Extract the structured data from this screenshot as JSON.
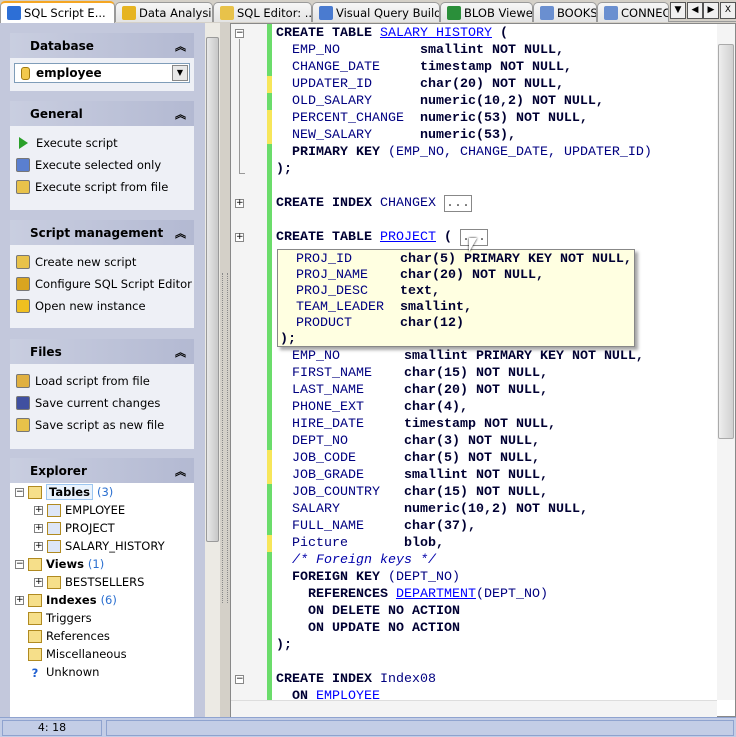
{
  "tabs": [
    {
      "label": "SQL Script E...",
      "icon": "lightning-script-icon",
      "active": true
    },
    {
      "label": "Data Analysis",
      "icon": "cube-icon"
    },
    {
      "label": "SQL Editor: ...",
      "icon": "database-doc-icon"
    },
    {
      "label": "Visual Query Builder",
      "icon": "builder-icon"
    },
    {
      "label": "BLOB Viewer",
      "icon": "image-icon"
    },
    {
      "label": "BOOKS",
      "icon": "table-icon"
    },
    {
      "label": "CONNEC",
      "icon": "table-icon"
    }
  ],
  "tab_controls": {
    "list": "▼",
    "prev": "◀",
    "next": "▶",
    "close": "X"
  },
  "panels": {
    "database": {
      "title": "Database",
      "selected": "employee"
    },
    "general": {
      "title": "General",
      "items": [
        {
          "label": "Execute script",
          "icon": "play-icon"
        },
        {
          "label": "Execute selected only",
          "icon": "execute-selected-icon"
        },
        {
          "label": "Execute script from file",
          "icon": "execute-file-icon"
        }
      ]
    },
    "script": {
      "title": "Script management",
      "items": [
        {
          "label": "Create new script",
          "icon": "new-script-icon"
        },
        {
          "label": "Configure SQL Script Editor",
          "icon": "configure-icon"
        },
        {
          "label": "Open new instance",
          "icon": "new-instance-icon"
        }
      ]
    },
    "files": {
      "title": "Files",
      "items": [
        {
          "label": "Load script from file",
          "icon": "load-icon"
        },
        {
          "label": "Save current changes",
          "icon": "save-icon"
        },
        {
          "label": "Save script as new file",
          "icon": "save-as-icon"
        }
      ]
    },
    "explorer": {
      "title": "Explorer",
      "tree": [
        {
          "label": "Tables",
          "count": "(3)",
          "bold": true,
          "level": 0,
          "exp": "−",
          "icon": "tables-folder-icon"
        },
        {
          "label": "EMPLOYEE",
          "level": 1,
          "exp": "+",
          "icon": "table-icon"
        },
        {
          "label": "PROJECT",
          "level": 1,
          "exp": "+",
          "icon": "table-icon"
        },
        {
          "label": "SALARY_HISTORY",
          "level": 1,
          "exp": "+",
          "icon": "table-icon"
        },
        {
          "label": "Views",
          "count": "(1)",
          "bold": true,
          "level": 0,
          "exp": "−",
          "icon": "views-folder-icon"
        },
        {
          "label": "BESTSELLERS",
          "level": 1,
          "exp": "+",
          "icon": "view-icon"
        },
        {
          "label": "Indexes",
          "count": "(6)",
          "bold": true,
          "level": 0,
          "exp": "+",
          "icon": "indexes-folder-icon"
        },
        {
          "label": "Triggers",
          "level": 0,
          "icon": "triggers-folder-icon"
        },
        {
          "label": "References",
          "level": 0,
          "icon": "references-folder-icon"
        },
        {
          "label": "Miscellaneous",
          "level": 0,
          "icon": "misc-icon"
        },
        {
          "label": "Unknown",
          "level": 0,
          "icon": "question-icon"
        }
      ]
    }
  },
  "editor": {
    "lines": [
      {
        "m": "g",
        "f": "−",
        "t": [
          [
            "kw",
            "CREATE TABLE "
          ],
          [
            "link",
            "SALARY_HISTORY"
          ],
          [
            "kw",
            " ("
          ]
        ]
      },
      {
        "m": "g",
        "t": [
          [
            "id",
            "  EMP_NO          "
          ],
          [
            "kw",
            "smallint NOT NULL,"
          ]
        ]
      },
      {
        "m": "g",
        "t": [
          [
            "id",
            "  CHANGE_DATE     "
          ],
          [
            "kw",
            "timestamp NOT NULL,"
          ]
        ]
      },
      {
        "m": "y",
        "t": [
          [
            "id",
            "  UPDATER_ID      "
          ],
          [
            "kw",
            "char(20) NOT NULL,"
          ]
        ]
      },
      {
        "m": "g",
        "t": [
          [
            "id",
            "  OLD_SALARY      "
          ],
          [
            "kw",
            "numeric(10,2) NOT NULL,"
          ]
        ]
      },
      {
        "m": "y",
        "t": [
          [
            "id",
            "  PERCENT_CHANGE  "
          ],
          [
            "kw",
            "numeric(53) NOT NULL,"
          ]
        ]
      },
      {
        "m": "y",
        "t": [
          [
            "id",
            "  NEW_SALARY      "
          ],
          [
            "kw",
            "numeric(53),"
          ]
        ]
      },
      {
        "m": "g",
        "t": [
          [
            "kw",
            "  PRIMARY KEY "
          ],
          [
            "id",
            "(EMP_NO, CHANGE_DATE, UPDATER_ID)"
          ]
        ]
      },
      {
        "m": "g",
        "t": [
          [
            "kw",
            ");"
          ]
        ]
      },
      {
        "m": "g",
        "t": []
      },
      {
        "m": "g",
        "f": "+",
        "t": [
          [
            "kw",
            "CREATE INDEX "
          ],
          [
            "id",
            "CHANGEX "
          ],
          [
            "bx",
            "..."
          ]
        ]
      },
      {
        "m": "g",
        "t": []
      },
      {
        "m": "g",
        "f": "+",
        "t": [
          [
            "kw",
            "CREATE TABLE "
          ],
          [
            "link",
            "PROJECT"
          ],
          [
            "kw",
            " ( "
          ],
          [
            "bx",
            "..."
          ]
        ]
      },
      {
        "m": "g",
        "t": []
      },
      {
        "m": "g",
        "t": []
      },
      {
        "m": "g",
        "t": []
      },
      {
        "m": "g",
        "t": []
      },
      {
        "m": "g",
        "t": []
      },
      {
        "m": "g",
        "t": []
      },
      {
        "m": "g",
        "t": [
          [
            "id",
            "  EMP_NO        "
          ],
          [
            "kw",
            "smallint PRIMARY KEY NOT NULL,"
          ]
        ]
      },
      {
        "m": "g",
        "t": [
          [
            "id",
            "  FIRST_NAME    "
          ],
          [
            "kw",
            "char(15) NOT NULL,"
          ]
        ]
      },
      {
        "m": "g",
        "t": [
          [
            "id",
            "  LAST_NAME     "
          ],
          [
            "kw",
            "char(20) NOT NULL,"
          ]
        ]
      },
      {
        "m": "g",
        "t": [
          [
            "id",
            "  PHONE_EXT     "
          ],
          [
            "kw",
            "char(4),"
          ]
        ]
      },
      {
        "m": "g",
        "t": [
          [
            "id",
            "  HIRE_DATE     "
          ],
          [
            "kw",
            "timestamp NOT NULL,"
          ]
        ]
      },
      {
        "m": "g",
        "t": [
          [
            "id",
            "  DEPT_NO       "
          ],
          [
            "kw",
            "char(3) NOT NULL,"
          ]
        ]
      },
      {
        "m": "y",
        "t": [
          [
            "id",
            "  JOB_CODE      "
          ],
          [
            "kw",
            "char(5) NOT NULL,"
          ]
        ]
      },
      {
        "m": "y",
        "t": [
          [
            "id",
            "  JOB_GRADE     "
          ],
          [
            "kw",
            "smallint NOT NULL,"
          ]
        ]
      },
      {
        "m": "g",
        "t": [
          [
            "id",
            "  JOB_COUNTRY   "
          ],
          [
            "kw",
            "char(15) NOT NULL,"
          ]
        ]
      },
      {
        "m": "g",
        "t": [
          [
            "id",
            "  SALARY        "
          ],
          [
            "kw",
            "numeric(10,2) NOT NULL,"
          ]
        ]
      },
      {
        "m": "g",
        "t": [
          [
            "id",
            "  FULL_NAME     "
          ],
          [
            "kw",
            "char(37),"
          ]
        ]
      },
      {
        "m": "y",
        "t": [
          [
            "id",
            "  Picture       "
          ],
          [
            "kw",
            "blob,"
          ]
        ]
      },
      {
        "m": "g",
        "t": [
          [
            "cm",
            "  /* Foreign keys */"
          ]
        ]
      },
      {
        "m": "g",
        "t": [
          [
            "kw",
            "  FOREIGN KEY "
          ],
          [
            "id",
            "(DEPT_NO)"
          ]
        ]
      },
      {
        "m": "g",
        "t": [
          [
            "kw",
            "    REFERENCES "
          ],
          [
            "link",
            "DEPARTMENT"
          ],
          [
            "id",
            "(DEPT_NO)"
          ]
        ]
      },
      {
        "m": "g",
        "t": [
          [
            "kw",
            "    ON DELETE NO ACTION"
          ]
        ]
      },
      {
        "m": "g",
        "t": [
          [
            "kw",
            "    ON UPDATE NO ACTION"
          ]
        ]
      },
      {
        "m": "g",
        "t": [
          [
            "kw",
            ");"
          ]
        ]
      },
      {
        "m": "g",
        "t": []
      },
      {
        "m": "g",
        "f": "−",
        "t": [
          [
            "kw",
            "CREATE INDEX "
          ],
          [
            "id",
            "Index08"
          ]
        ]
      },
      {
        "m": "g",
        "t": [
          [
            "kw",
            "  ON "
          ],
          [
            "link",
            "EMPLOYEE"
          ]
        ]
      }
    ],
    "tooltip": [
      [
        [
          "id",
          "  PROJ_ID      "
        ],
        [
          "kw",
          "char(5) PRIMARY KEY NOT NULL,"
        ]
      ],
      [
        [
          "id",
          "  PROJ_NAME    "
        ],
        [
          "kw",
          "char(20) NOT NULL,"
        ]
      ],
      [
        [
          "id",
          "  PROJ_DESC    "
        ],
        [
          "kw",
          "text,"
        ]
      ],
      [
        [
          "id",
          "  TEAM_LEADER  "
        ],
        [
          "kw",
          "smallint,"
        ]
      ],
      [
        [
          "id",
          "  PRODUCT      "
        ],
        [
          "kw",
          "char(12)"
        ]
      ],
      [
        [
          "kw",
          ");"
        ]
      ]
    ],
    "colors": {
      "modified_saved": "#6bdc6b",
      "modified_unsaved": "#f7e65a",
      "tooltip_bg": "#ffffe1"
    }
  },
  "status": {
    "position": "4:    18"
  }
}
